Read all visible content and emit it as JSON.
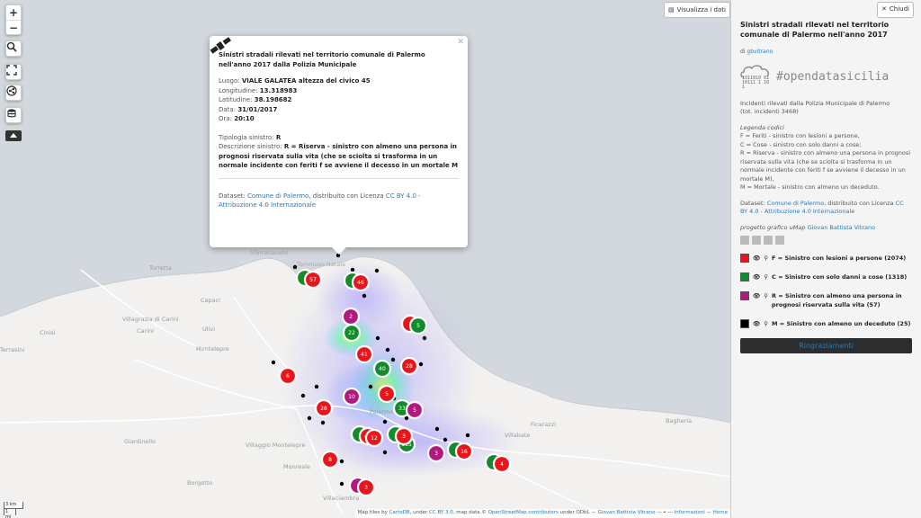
{
  "controls": {
    "zoom_in": "+",
    "zoom_out": "−",
    "icons": [
      "search-icon",
      "fullscreen-icon",
      "share-icon",
      "layers-icon"
    ]
  },
  "map_buttons": {
    "view_data": "Visualizza i dati",
    "close": "Chiudi"
  },
  "popup": {
    "icon": "satellite-icon",
    "title": "Sinistri stradali rilevati nel territorio comunale di Palermo nell'anno 2017 dalla Polizia Municipale",
    "luogo_label": "Luogo:",
    "luogo": "VIALE GALATEA altezza del civico 45",
    "longitudine_label": "Longitudine:",
    "longitudine": "13.318983",
    "latitudine_label": "Latitudine:",
    "latitudine": "38.198682",
    "data_label": "Data:",
    "data": "31/01/2017",
    "ora_label": "Ora:",
    "ora": "20:10",
    "tipologia_label": "Tipologia sinistro:",
    "tipologia": "R",
    "descrizione_label": "Descrizione sinistro:",
    "descrizione": "R = Riserva - sinistro con almeno una persona in prognosi riservata sulla vita (che se sciolta si trasforma in un normale incidente con feriti f se avviene il decesso in un mortale M",
    "dataset_prefix": "Dataset:",
    "dataset_link": "Comune di Palermo",
    "dataset_mid": ", distribuito con Licenza",
    "dataset_license": "CC BY 4.0 - Attribuzione 4.0 Internazionale"
  },
  "map_labels": [
    {
      "text": "Sferracavallo",
      "c": 1
    },
    {
      "text": "Tommaso Natale",
      "c": 1
    },
    {
      "text": "Capaci",
      "c": 0
    },
    {
      "text": "Villagrazia di Carini",
      "c": 0
    },
    {
      "text": "Carini",
      "c": 0
    },
    {
      "text": "Terrasini",
      "c": 0
    },
    {
      "text": "Cinisi",
      "c": 0
    },
    {
      "text": "Torretta",
      "c": 0
    },
    {
      "text": "Ulivi",
      "c": 0
    },
    {
      "text": "Montelepre",
      "c": 0
    },
    {
      "text": "Giardinello",
      "c": 0
    },
    {
      "text": "Borgetto",
      "c": 0
    },
    {
      "text": "Villaggio Montelepre",
      "c": 0
    },
    {
      "text": "Monreale",
      "c": 0
    },
    {
      "text": "Villaciambra",
      "c": 0
    },
    {
      "text": "Palermo",
      "c": 0
    },
    {
      "text": "Ficarazzi",
      "c": 0
    },
    {
      "text": "Villabate",
      "c": 0
    },
    {
      "text": "Bagheria",
      "c": 0
    }
  ],
  "markers": [
    {
      "kind": "pair",
      "cat": [
        "C",
        "F"
      ],
      "label": "57"
    },
    {
      "kind": "pair",
      "cat": [
        "C",
        "F"
      ],
      "label": "46"
    },
    {
      "kind": "single",
      "cat": "R",
      "label": "2"
    },
    {
      "kind": "pair",
      "cat": [
        "F",
        "C"
      ],
      "label": "5"
    },
    {
      "kind": "single",
      "cat": "C",
      "label": "22"
    },
    {
      "kind": "single",
      "cat": "F",
      "label": "41"
    },
    {
      "kind": "single",
      "cat": "C",
      "label": "40"
    },
    {
      "kind": "single",
      "cat": "F",
      "label": "28"
    },
    {
      "kind": "single",
      "cat": "F",
      "label": "6"
    },
    {
      "kind": "single",
      "cat": "R",
      "label": "10"
    },
    {
      "kind": "single",
      "cat": "F",
      "label": "5"
    },
    {
      "kind": "single",
      "cat": "C",
      "label": "33"
    },
    {
      "kind": "single",
      "cat": "R",
      "label": "5"
    },
    {
      "kind": "single",
      "cat": "F",
      "label": "28"
    },
    {
      "kind": "pair",
      "cat": [
        "C",
        "F"
      ],
      "label": "44"
    },
    {
      "kind": "single",
      "cat": "C",
      "label": "115"
    },
    {
      "kind": "single",
      "cat": "F",
      "label": "8"
    },
    {
      "kind": "single",
      "cat": "R",
      "label": "3"
    },
    {
      "kind": "pair",
      "cat": [
        "C",
        "F"
      ],
      "label": "16"
    },
    {
      "kind": "pair",
      "cat": [
        "C",
        "F"
      ],
      "label": "4"
    },
    {
      "kind": "pair",
      "cat": [
        "R",
        "F"
      ],
      "label": "3"
    },
    {
      "kind": "pair",
      "cat": [
        "C",
        "F"
      ],
      "label": "3"
    },
    {
      "kind": "single",
      "cat": "F",
      "label": "12"
    }
  ],
  "scale": {
    "km": "3 km",
    "mi": "1 mi"
  },
  "attribution": {
    "prefix": "Map tiles by",
    "carto": "CartoDB",
    "under1": ", under",
    "ccby": "CC BY 3.0",
    "data": ". map data ©",
    "osm": "OpenStreetMap contributors",
    "under2": "under ODbL —",
    "author": "Giovan Battista Vitrano",
    "sep": "—",
    "info": "Informazioni",
    "dash": "—",
    "home": "Home"
  },
  "panel": {
    "title": "Sinistri stradali rilevati nel territorio comunale di Palermo nell'anno 2017",
    "by_prefix": "di",
    "by_user": "gbvitrano",
    "logo_bits": "1011010 0110111 1 10 1",
    "logo_text": "#opendatasicilia",
    "intro": "Incidenti rilevati dalla Polizia Municipale di Palermo",
    "intro_total": "(tot. incidenti 3468)",
    "legend_title": "Legenda codici",
    "code_f": "F = Feriti - sinistro con lesioni a persone,",
    "code_c": "C = Cose - sinistro con solo danni a cose;",
    "code_r": "R = Riserva - sinistro con almeno una persona in prognosi riservata sulla vita (che se sciolta si trasforma in un normale incidente con feriti f se avviene il decesso in un mortale M),",
    "code_m": "M = Mortale - sinistro con almeno un deceduto.",
    "dataset_prefix": "Dataset:",
    "dataset_link": "Comune di Palermo",
    "dataset_mid": ", distribuito con Licenza",
    "dataset_license": "CC BY 4.0 - Attribuzione 4.0 Internazionale",
    "credit_prefix": "progetto grafico uMap",
    "credit_link": "Giovan Battista Vitrano",
    "social": [
      "home-icon",
      "twitter-icon",
      "email-icon",
      "facebook-icon"
    ],
    "layers": [
      {
        "color": "#e8151b",
        "label": "F = Sinistro con lesioni a persone (2074)"
      },
      {
        "color": "#138a2c",
        "label": "C = Sinistro con solo danni a cose (1318)"
      },
      {
        "color": "#b0197e",
        "label": "R = Sinistro con almeno una persona in prognosi riservata sulla vita (57)"
      },
      {
        "color": "#000000",
        "label": "M = Sinistro con almeno un deceduto (25)"
      }
    ],
    "thanks_button": "Ringraziamenti"
  },
  "colors": {
    "F": "#e8151b",
    "C": "#138a2c",
    "R": "#b0197e",
    "M": "#000000"
  }
}
